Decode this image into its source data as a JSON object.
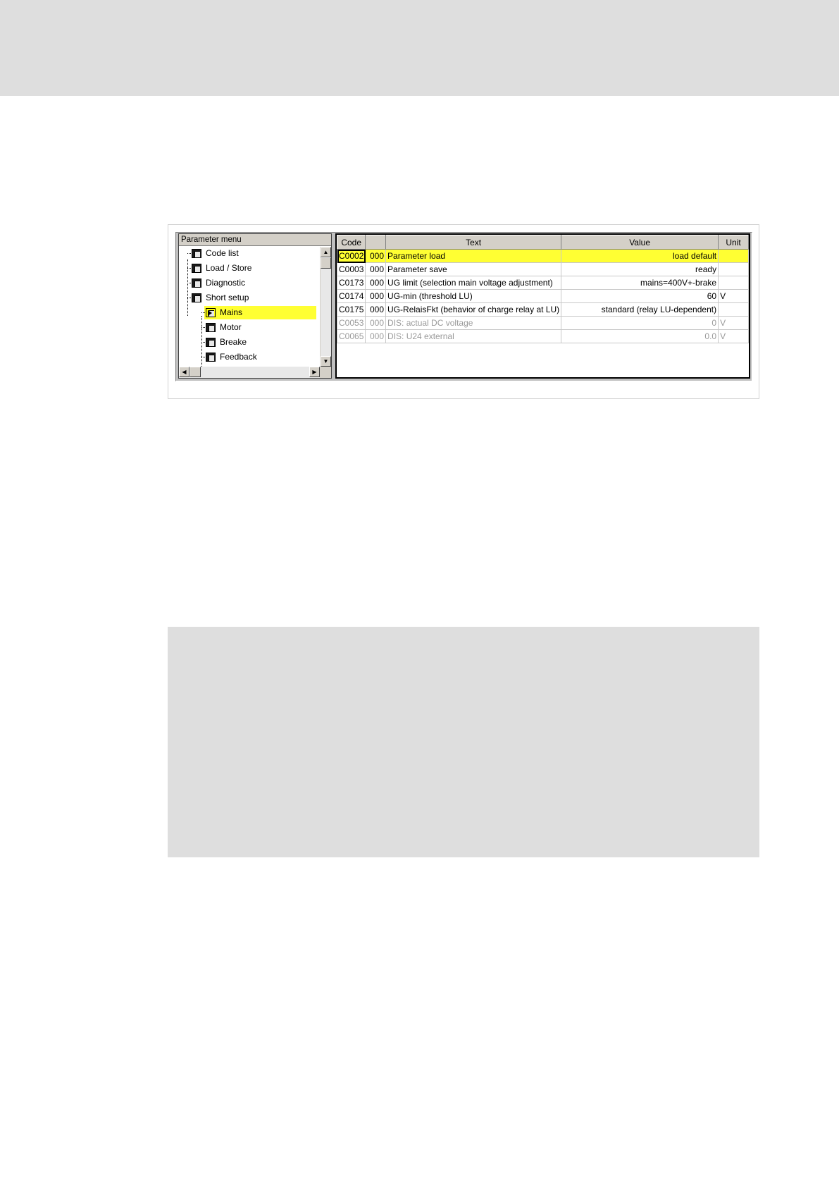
{
  "tree": {
    "header": "Parameter menu",
    "items": [
      {
        "label": "Code list",
        "level": 0
      },
      {
        "label": "Load / Store",
        "level": 0
      },
      {
        "label": "Diagnostic",
        "level": 0
      },
      {
        "label": "Short setup",
        "level": 0
      },
      {
        "label": "Mains",
        "level": 1,
        "selected": true
      },
      {
        "label": "Motor",
        "level": 1
      },
      {
        "label": "Breake",
        "level": 1
      },
      {
        "label": "Feedback",
        "level": 1
      }
    ]
  },
  "table": {
    "headers": [
      "Code",
      "",
      "Text",
      "Value",
      "Unit"
    ],
    "rows": [
      {
        "code": "C0002",
        "sub": "000",
        "text": "Parameter load",
        "value": "load default",
        "unit": "",
        "highlighted": true
      },
      {
        "code": "C0003",
        "sub": "000",
        "text": "Parameter save",
        "value": "ready",
        "unit": ""
      },
      {
        "code": "C0173",
        "sub": "000",
        "text": "UG limit (selection main voltage adjustment)",
        "value": "mains=400V+-brake",
        "unit": ""
      },
      {
        "code": "C0174",
        "sub": "000",
        "text": "UG-min (threshold LU)",
        "value": "60",
        "unit": "V"
      },
      {
        "code": "C0175",
        "sub": "000",
        "text": "UG-RelaisFkt (behavior of charge relay at LU)",
        "value": "standard (relay LU-dependent)",
        "unit": ""
      },
      {
        "code": "C0053",
        "sub": "000",
        "text": "DIS: actual DC voltage",
        "value": "0",
        "unit": "V",
        "readonly": true
      },
      {
        "code": "C0065",
        "sub": "000",
        "text": "DIS: U24 external",
        "value": "0.0",
        "unit": "V",
        "readonly": true
      }
    ]
  },
  "colors": {
    "highlight": "#ffff33",
    "readonly_text": "#9a9a9a",
    "panel_gray": "#dedede"
  },
  "icons": {
    "tree_node": "folder-page-icon",
    "scroll_up": "arrow-up-icon",
    "scroll_down": "arrow-down-icon",
    "scroll_left": "arrow-left-icon",
    "scroll_right": "arrow-right-icon"
  }
}
